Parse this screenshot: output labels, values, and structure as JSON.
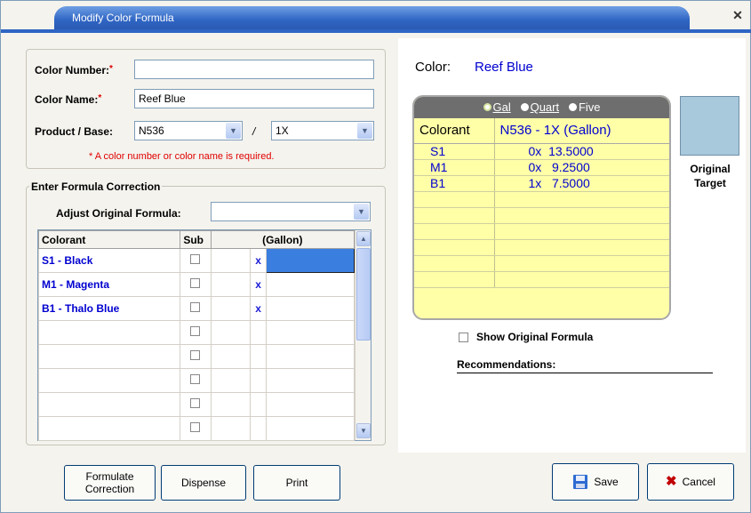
{
  "window": {
    "title": "Modify Color Formula",
    "close_glyph": "✕"
  },
  "form": {
    "color_number_label": "Color Number:",
    "color_number_value": "",
    "color_name_label": "Color Name:",
    "color_name_value": "Reef Blue",
    "product_base_label": "Product / Base:",
    "product_value": "N536",
    "slash": "/",
    "base_value": "1X",
    "required_star": "*",
    "required_note": "* A color number or color name is required."
  },
  "correction": {
    "group_title": "Enter Formula Correction",
    "adjust_label": "Adjust Original Formula:",
    "adjust_value": "",
    "headers": {
      "colorant": "Colorant",
      "sub": "Sub",
      "gallon": "(Gallon)"
    },
    "x_mark": "x",
    "rows": [
      {
        "colorant": "S1 - Black",
        "x": "x"
      },
      {
        "colorant": "M1 - Magenta",
        "x": "x"
      },
      {
        "colorant": "B1 - Thalo Blue",
        "x": "x"
      },
      {
        "colorant": "",
        "x": ""
      },
      {
        "colorant": "",
        "x": ""
      },
      {
        "colorant": "",
        "x": ""
      },
      {
        "colorant": "",
        "x": ""
      },
      {
        "colorant": "",
        "x": ""
      }
    ]
  },
  "right": {
    "color_label": "Color:",
    "color_value": "Reef Blue",
    "units": {
      "gal": "Gal",
      "quart": "Quart",
      "five": "Five",
      "selected": "gal"
    },
    "formula_header": {
      "colorant": "Colorant",
      "base": "N536 - 1X  (Gallon)"
    },
    "formula_rows": [
      {
        "colorant": "S1",
        "amount": "0x  13.5000"
      },
      {
        "colorant": "M1",
        "amount": "0x   9.2500"
      },
      {
        "colorant": "B1",
        "amount": "1x   7.5000"
      },
      {
        "colorant": "",
        "amount": ""
      },
      {
        "colorant": "",
        "amount": ""
      },
      {
        "colorant": "",
        "amount": ""
      },
      {
        "colorant": "",
        "amount": ""
      },
      {
        "colorant": "",
        "amount": ""
      },
      {
        "colorant": "",
        "amount": ""
      }
    ],
    "swatch_color": "#a8c8dc",
    "swatch_label_1": "Original",
    "swatch_label_2": "Target",
    "show_original_label": "Show Original Formula",
    "recommendations_label": "Recommendations:"
  },
  "buttons": {
    "formulate_line1": "Formulate",
    "formulate_line2": "Correction",
    "dispense": "Dispense",
    "print": "Print",
    "save": "Save",
    "cancel": "Cancel"
  }
}
